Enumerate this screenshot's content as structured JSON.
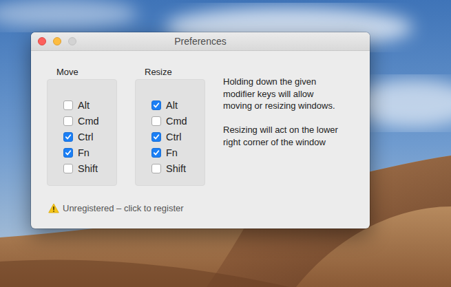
{
  "window": {
    "title": "Preferences"
  },
  "groups": [
    {
      "label": "Move",
      "options": [
        {
          "label": "Alt",
          "checked": false
        },
        {
          "label": "Cmd",
          "checked": false
        },
        {
          "label": "Ctrl",
          "checked": true
        },
        {
          "label": "Fn",
          "checked": true
        },
        {
          "label": "Shift",
          "checked": false
        }
      ]
    },
    {
      "label": "Resize",
      "options": [
        {
          "label": "Alt",
          "checked": true
        },
        {
          "label": "Cmd",
          "checked": false
        },
        {
          "label": "Ctrl",
          "checked": true
        },
        {
          "label": "Fn",
          "checked": true
        },
        {
          "label": "Shift",
          "checked": false
        }
      ]
    }
  ],
  "description": [
    "Holding down the given modifier keys will allow moving or resizing windows.",
    "Resizing will act on the lower right corner of the window"
  ],
  "registration": {
    "text": "Unregistered – click to register"
  }
}
